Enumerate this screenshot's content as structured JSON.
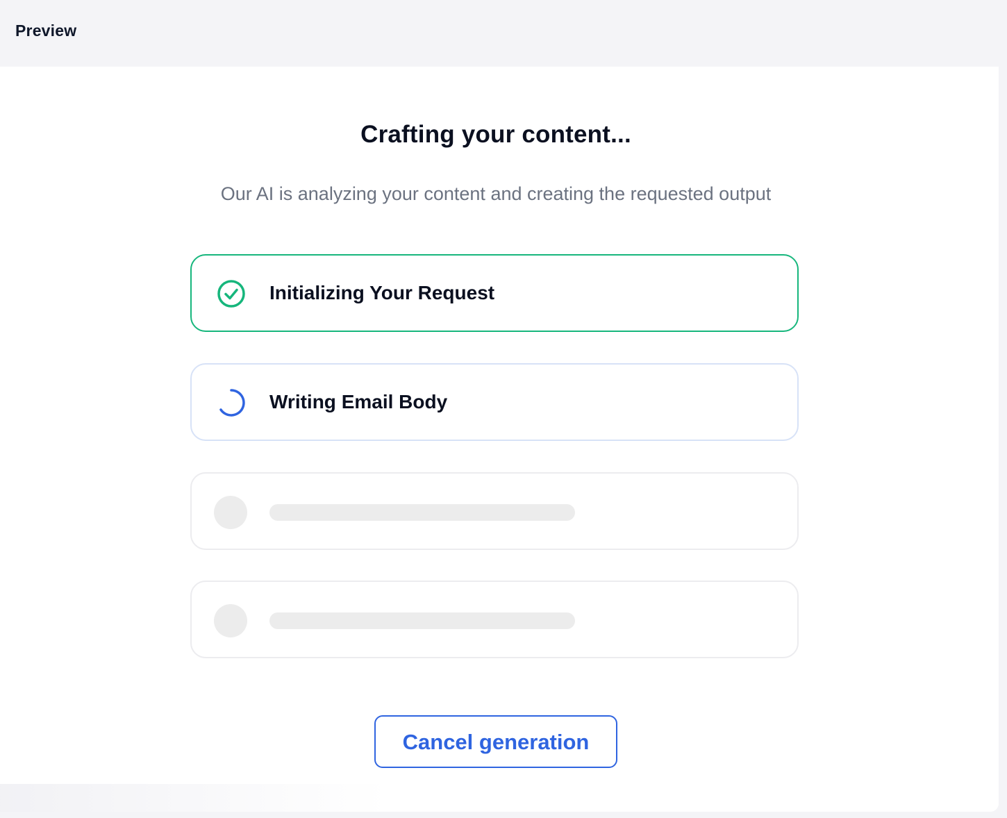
{
  "header": {
    "title": "Preview"
  },
  "main": {
    "title": "Crafting your content...",
    "subtitle": "Our AI is analyzing your content and creating the requested output",
    "steps": [
      {
        "label": "Initializing Your Request",
        "status": "completed",
        "icon": "check-circle-icon"
      },
      {
        "label": "Writing Email Body",
        "status": "in-progress",
        "icon": "spinner-icon"
      },
      {
        "label": "",
        "status": "pending",
        "icon": "placeholder-dot"
      },
      {
        "label": "",
        "status": "pending",
        "icon": "placeholder-dot"
      }
    ],
    "cancel_label": "Cancel generation"
  },
  "colors": {
    "success": "#16b67c",
    "accent": "#2f64e0",
    "skeleton": "#ececec"
  }
}
